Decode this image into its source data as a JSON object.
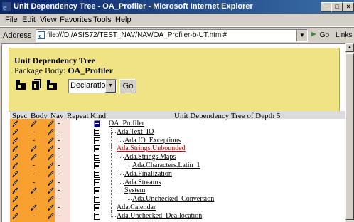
{
  "window": {
    "title": "Unit Dependency Tree - OA_Profiler - Microsoft Internet Explorer",
    "min_glyph": "_",
    "max_glyph": "□",
    "close_glyph": "×"
  },
  "menu": {
    "file": "File",
    "edit": "Edit",
    "view": "View",
    "favorites": "Favorites",
    "tools": "Tools",
    "help": "Help"
  },
  "address": {
    "label": "Address",
    "url": "file:///D:/ASIS72/TEST_NAV/NAV/OA_Profiler-b-UT.html#",
    "go_label": "Go",
    "links_label": "Links"
  },
  "panel": {
    "title": "Unit Dependency Tree",
    "package_label": "Package Body:",
    "package_name": "OA_Profiler",
    "select_value": "Declaration",
    "go_button": "Go"
  },
  "table": {
    "headers": {
      "spec": "Spec",
      "body": "Body",
      "nav": "Nav",
      "repeat": "Repeat",
      "kind": "Kind",
      "tree": "Unit Dependency Tree of Depth 5"
    },
    "rows": [
      {
        "name": "OA_Profiler",
        "depth": 0,
        "color": "#000000",
        "spec": true,
        "body": true,
        "nav": true,
        "repeat": "-",
        "kind": "package-body"
      },
      {
        "name": "Ada.Text_IO",
        "depth": 1,
        "color": "#000000",
        "spec": true,
        "body": false,
        "nav": true,
        "repeat": "-",
        "kind": "package"
      },
      {
        "name": "Ada.IO_Exceptions",
        "depth": 2,
        "color": "#000000",
        "spec": true,
        "body": false,
        "nav": true,
        "repeat": "-",
        "kind": "package"
      },
      {
        "name": "Ada.Strings.Unbounded",
        "depth": 1,
        "color": "#cc0000",
        "spec": true,
        "body": true,
        "nav": true,
        "repeat": "-",
        "kind": "package"
      },
      {
        "name": "Ada.Strings.Maps",
        "depth": 2,
        "color": "#000000",
        "spec": true,
        "body": true,
        "nav": true,
        "repeat": "-",
        "kind": "package"
      },
      {
        "name": "Ada.Characters.Latin_1",
        "depth": 3,
        "color": "#000000",
        "spec": true,
        "body": false,
        "nav": true,
        "repeat": "-",
        "kind": "package"
      },
      {
        "name": "Ada.Finalization",
        "depth": 2,
        "color": "#000000",
        "spec": true,
        "body": false,
        "nav": true,
        "repeat": "-",
        "kind": "package"
      },
      {
        "name": "Ada.Streams",
        "depth": 2,
        "color": "#000000",
        "spec": true,
        "body": false,
        "nav": true,
        "repeat": "-",
        "kind": "package"
      },
      {
        "name": "System",
        "depth": 2,
        "color": "#000000",
        "spec": true,
        "body": true,
        "nav": true,
        "repeat": "-",
        "kind": "package"
      },
      {
        "name": "Ada.Unchecked_Conversion",
        "depth": 3,
        "color": "#000000",
        "spec": true,
        "body": false,
        "nav": true,
        "repeat": "-",
        "kind": "generic"
      },
      {
        "name": "Ada.Calendar",
        "depth": 1,
        "color": "#000000",
        "spec": true,
        "body": true,
        "nav": true,
        "repeat": "-",
        "kind": "package"
      },
      {
        "name": "Ada.Unchecked_Deallocation",
        "depth": 1,
        "color": "#000000",
        "spec": true,
        "body": false,
        "nav": true,
        "repeat": "-",
        "kind": "generic"
      }
    ]
  },
  "icons": {
    "app": "ie-logo-icon",
    "page": "page-icon",
    "spec_pen": "pen-icon",
    "kind_doc": "document-icon"
  }
}
